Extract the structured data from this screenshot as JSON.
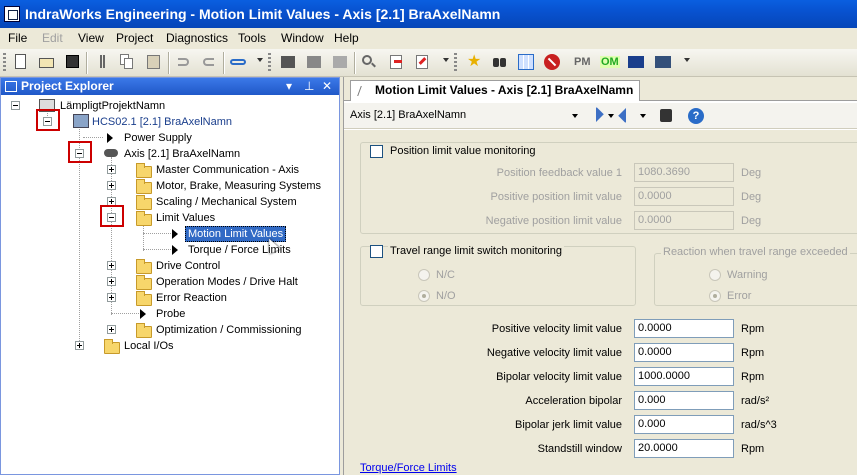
{
  "window": {
    "title": "IndraWorks Engineering - Motion Limit Values - Axis [2.1] BraAxelNamn"
  },
  "menu": [
    "File",
    "Edit",
    "View",
    "Project",
    "Diagnostics",
    "Tools",
    "Window",
    "Help"
  ],
  "menu_disabled": [
    "Edit"
  ],
  "toolbar": {
    "pm_label": "PM",
    "om_label": "OM"
  },
  "explorer": {
    "title": "Project Explorer",
    "nodes": {
      "project": "LämpligtProjektNamn",
      "device": "HCS02.1 [2.1] BraAxelNamn",
      "power_supply": "Power Supply",
      "axis": "Axis [2.1] BraAxelNamn",
      "master_comm": "Master Communication - Axis",
      "motor": "Motor, Brake, Measuring Systems",
      "scaling": "Scaling / Mechanical System",
      "limit_values": "Limit Values",
      "motion_limit_values": "Motion Limit Values",
      "torque_force_limits": "Torque / Force Limits",
      "drive_control": "Drive Control",
      "operation_modes": "Operation Modes / Drive Halt",
      "error_reaction": "Error Reaction",
      "probe": "Probe",
      "optimization": "Optimization / Commissioning",
      "local_io": "Local I/Os"
    }
  },
  "editor": {
    "tab_label": "Motion Limit Values - Axis [2.1] BraAxelNamn",
    "axis_select": "Axis [2.1] BraAxelNamn",
    "position_monitoring": {
      "label": "Position limit value monitoring",
      "checked": false,
      "rows": [
        {
          "label": "Position feedback value 1",
          "value": "1080.3690",
          "unit": "Deg"
        },
        {
          "label": "Positive position limit value",
          "value": "0.0000",
          "unit": "Deg"
        },
        {
          "label": "Negative position limit value",
          "value": "0.0000",
          "unit": "Deg"
        }
      ]
    },
    "travel_range": {
      "label": "Travel range limit switch monitoring",
      "checked": false,
      "options": [
        "N/C",
        "N/O"
      ],
      "selected": "N/O",
      "reaction_title": "Reaction when travel range exceeded",
      "reaction_options": [
        "Warning",
        "Error"
      ],
      "reaction_selected": "Error"
    },
    "limits": [
      {
        "label": "Positive velocity limit value",
        "value": "0.0000",
        "unit": "Rpm"
      },
      {
        "label": "Negative velocity limit value",
        "value": "0.0000",
        "unit": "Rpm"
      },
      {
        "label": "Bipolar velocity limit value",
        "value": "1000.0000",
        "unit": "Rpm"
      },
      {
        "label": "Acceleration bipolar",
        "value": "0.000",
        "unit": "rad/s²"
      },
      {
        "label": "Bipolar jerk limit value",
        "value": "0.000",
        "unit": "rad/s^3"
      },
      {
        "label": "Standstill window",
        "value": "20.0000",
        "unit": "Rpm"
      }
    ],
    "link_label": "Torque/Force Limits"
  }
}
